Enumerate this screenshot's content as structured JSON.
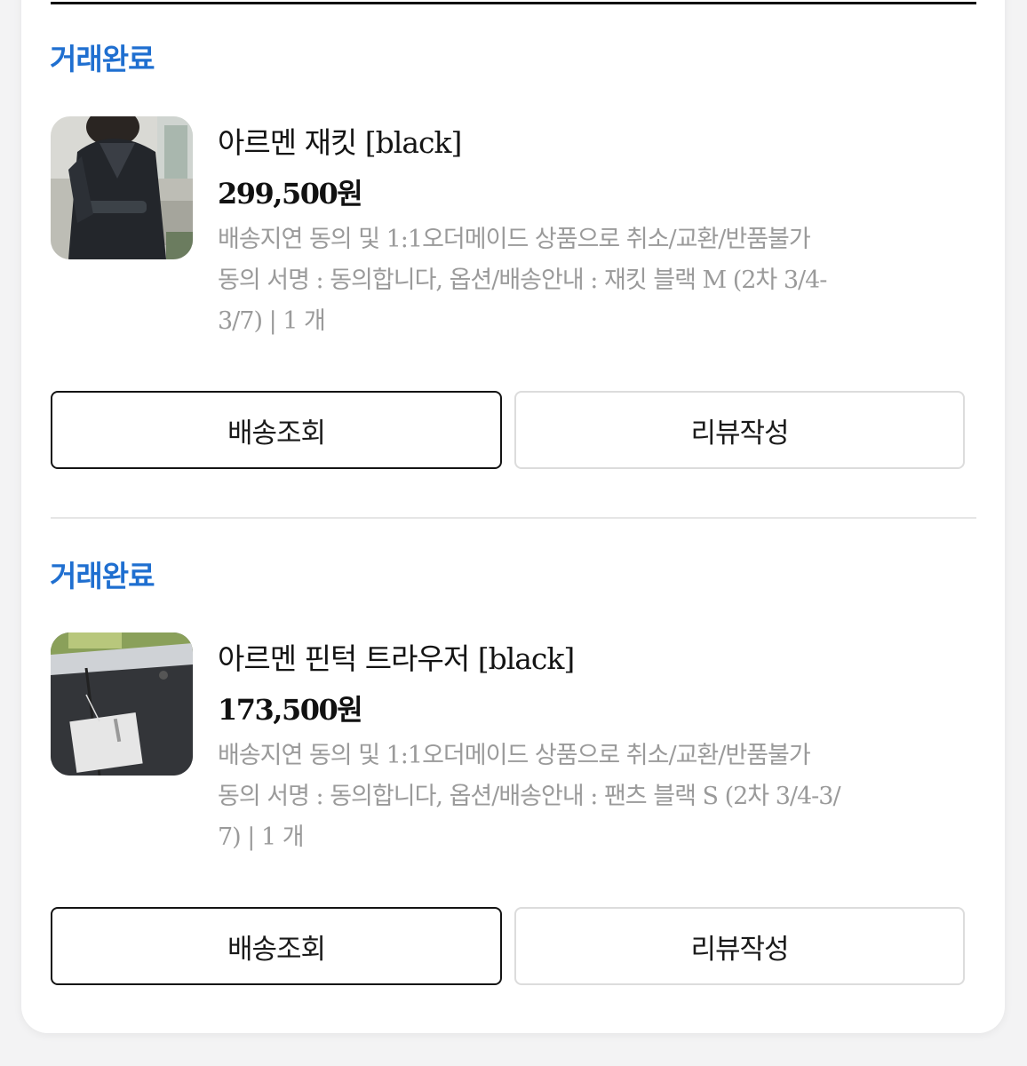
{
  "orders": [
    {
      "status": "거래완료",
      "product_title": "아르멘 재킷 [black]",
      "price": "299,500원",
      "option_lines": [
        "배송지연 동의 및 1:1오더메이드 상품으로 취소/교환/반품불가",
        "동의 서명 : 동의합니다, 옵션/배송안내 : 재킷 블랙 M (2차 3/4-",
        "3/7) | 1 개"
      ],
      "track_button": "배송조회",
      "review_button": "리뷰작성"
    },
    {
      "status": "거래완료",
      "product_title": "아르멘 핀턱 트라우저 [black]",
      "price": "173,500원",
      "option_lines": [
        "배송지연 동의 및 1:1오더메이드 상품으로 취소/교환/반품불가",
        "동의 서명 : 동의합니다, 옵션/배송안내 : 팬츠 블랙 S (2차 3/4-3/",
        "7) | 1 개"
      ],
      "track_button": "배송조회",
      "review_button": "리뷰작성"
    }
  ],
  "colors": {
    "status": "#1f6fd0",
    "primary_button_border": "#141414",
    "secondary_button_border": "#dcdcdc",
    "muted_text": "#9a9a9a"
  }
}
